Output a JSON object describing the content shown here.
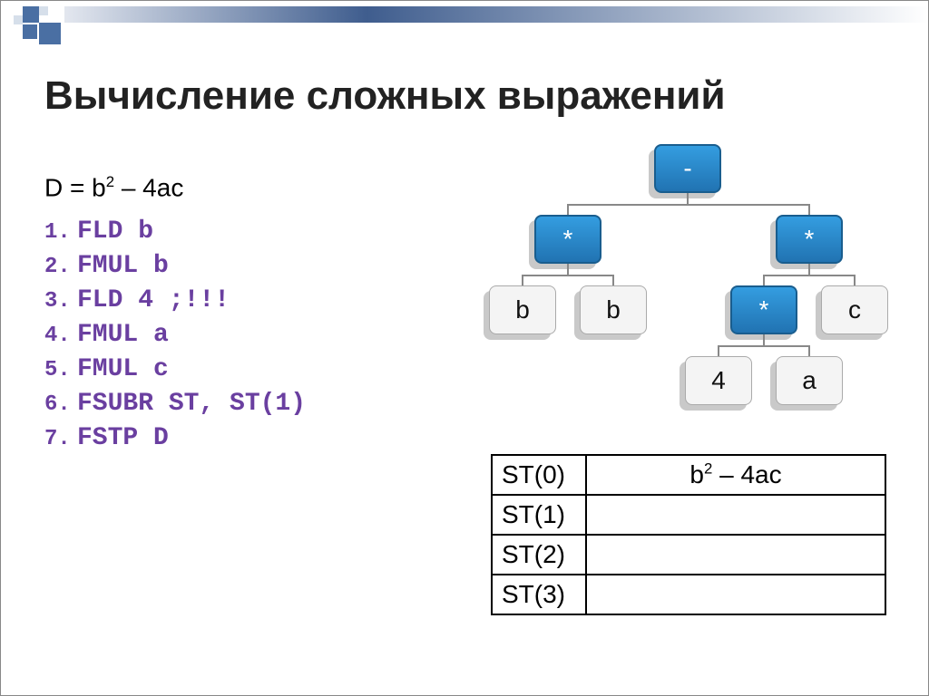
{
  "title": "Вычисление сложных выражений",
  "formula": {
    "prefix": "D = b",
    "sup": "2",
    "rest": " – 4ac"
  },
  "code": [
    "FLD b",
    "FMUL b",
    "FLD 4 ;!!!",
    "FMUL a",
    "FMUL c",
    "FSUBR ST, ST(1)",
    "FSTP D"
  ],
  "tree": {
    "root": "-",
    "mulL": "*",
    "mulR": "*",
    "b1": "b",
    "b2": "b",
    "mulRR": "*",
    "c": "c",
    "four": "4",
    "a": "a"
  },
  "stack": {
    "rows": [
      {
        "label": "ST(0)",
        "value_html": "b<sup>2</sup> – 4ac"
      },
      {
        "label": "ST(1)",
        "value_html": ""
      },
      {
        "label": "ST(2)",
        "value_html": ""
      },
      {
        "label": "ST(3)",
        "value_html": ""
      }
    ]
  }
}
